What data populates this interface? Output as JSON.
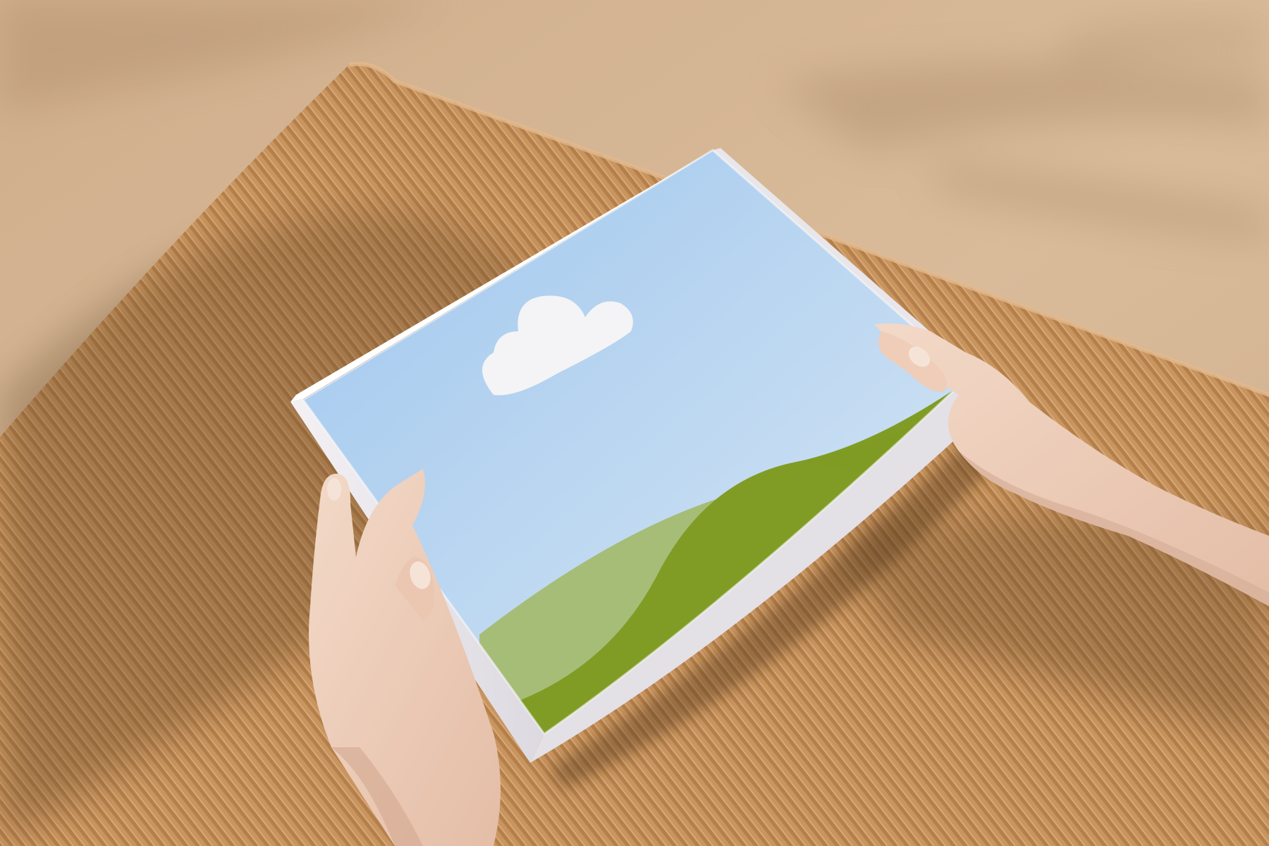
{
  "photo": {
    "colors": {
      "backdrop": "#d5b594",
      "backdrop_shadow": "#b89673",
      "cardboard": "#c9955f",
      "cardboard_rib": "#a9743f",
      "box_white": "#f2f0f3",
      "box_side_shade": "#d9d6dd",
      "sky_top": "#9fc7ef",
      "sky_bottom": "#d6e6f4",
      "hill_green": "#7f9b24",
      "hill_light": "#a9c07a",
      "cloud": "#f4f4f6",
      "skin": "#f0d2bf",
      "skin_shadow": "#d9b29c",
      "nail": "#f6e3d8"
    },
    "objects": [
      "corrugated-cardboard-sheet",
      "mailer-box",
      "sky-illustration",
      "cloud",
      "green-hills",
      "left-hand",
      "right-hand",
      "leaf-shadows"
    ]
  }
}
